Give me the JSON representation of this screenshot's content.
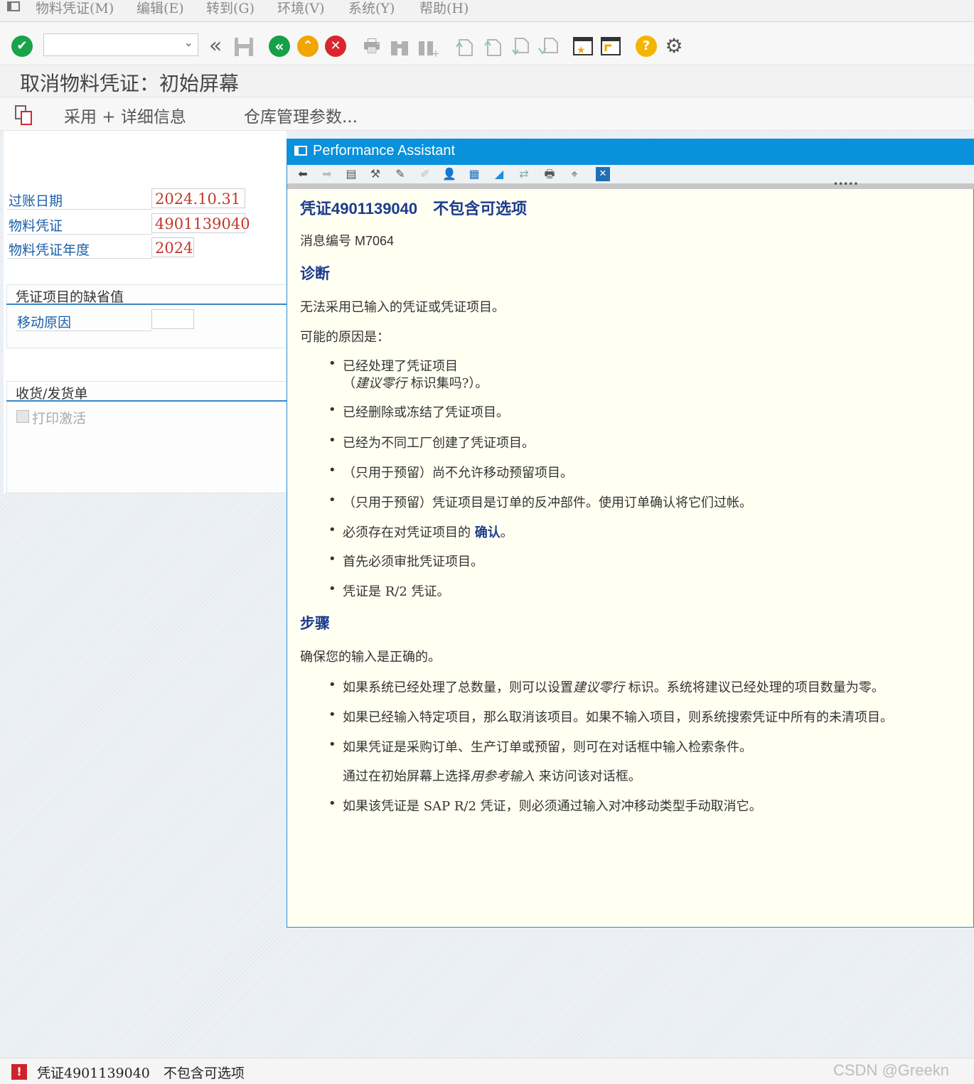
{
  "menubar": {
    "items": [
      "物料凭证(M)",
      "编辑(E)",
      "转到(G)",
      "环境(V)",
      "系统(Y)",
      "帮助(H)"
    ]
  },
  "toolbar": {
    "command_field_value": ""
  },
  "page": {
    "title": "取消物料凭证：初始屏幕"
  },
  "app_toolbar": {
    "adopt_details_label": "采用 + 详细信息",
    "warehouse_params_label": "仓库管理参数..."
  },
  "form": {
    "posting_date_label": "过账日期",
    "posting_date_value": "2024.10.31",
    "material_doc_label": "物料凭证",
    "material_doc_value": "4901139040",
    "material_doc_year_label": "物料凭证年度",
    "material_doc_year_value": "2024",
    "defaults_group_title": "凭证项目的缺省值",
    "movement_reason_label": "移动原因",
    "movement_reason_value": "",
    "gr_gi_group_title": "收货/发货单",
    "print_active_label": "打印激活"
  },
  "performance_assistant": {
    "title": "Performance Assistant",
    "heading": "凭证4901139040　不包含可选项",
    "message_no": "消息编号 M7064",
    "diagnosis_title": "诊断",
    "diagnosis_text": "无法采用已输入的凭证或凭证项目。",
    "possible_reasons": "可能的原因是：",
    "reasons": [
      "已经处理了凭证项目",
      "已经删除或冻结了凭证项目。",
      "已经为不同工厂创建了凭证项目。",
      "（只用于预留）尚不允许移动预留项目。",
      "（只用于预留）凭证项目是订单的反冲部件。使用订单确认将它们过帐。",
      "首先必须审批凭证项目。",
      "凭证是 R/2 凭证。"
    ],
    "reason1_line2_pre": "（",
    "reason1_line2_em": "建议零行",
    "reason1_line2_post": " 标识集吗?）。",
    "reason_confirm_pre": "必须存在对凭证项目的 ",
    "reason_confirm_kw": "确认",
    "reason_confirm_post": "。",
    "steps_title": "步骤",
    "steps_text": "确保您的输入是正确的。",
    "step1_pre": "如果系统已经处理了总数量，则可以设置",
    "step1_em": "建议零行",
    "step1_post": " 标识。系统将建议已经处理的项目数量为零。",
    "step2": "如果已经输入特定项目，那么取消该项目。如果不输入项目，则系统搜索凭证中所有的未清项目。",
    "step3": "如果凭证是采购订单、生产订单或预留，则可在对话框中输入检索条件。",
    "step3_sub_pre": "通过在初始屏幕上选择",
    "step3_sub_em": "用参考输入",
    "step3_sub_post": " 来访问该对话框。",
    "step4": "如果该凭证是 SAP R/2 凭证，则必须通过输入对冲移动类型手动取消它。"
  },
  "statusbar": {
    "message": "凭证4901139040　不包含可选项",
    "watermark": "CSDN @Greekn"
  },
  "colors": {
    "accent": "#0a91db",
    "label_blue": "#1a5fa8",
    "value_red": "#c0392b",
    "error_red": "#d0222a"
  }
}
